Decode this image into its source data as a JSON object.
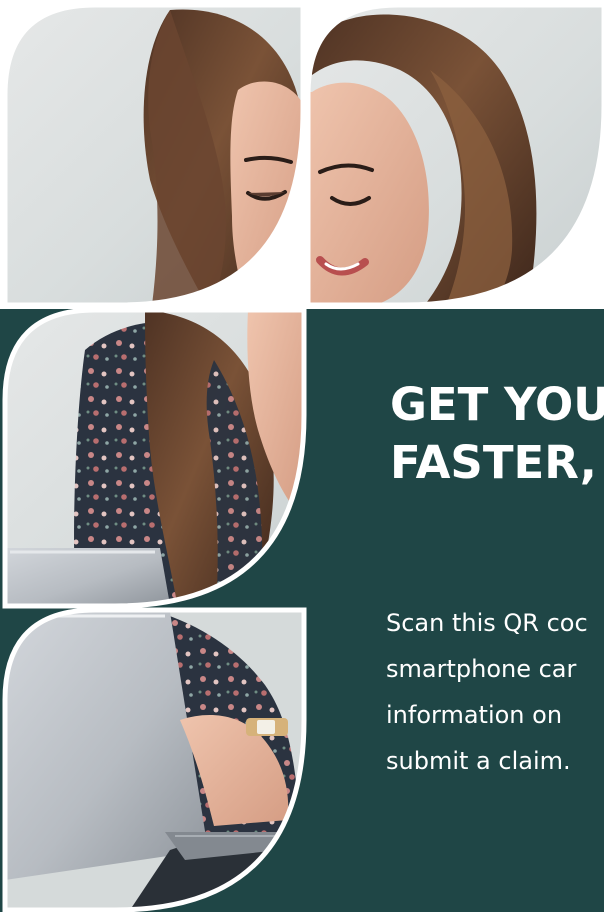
{
  "headline": {
    "line_1": "GET YOU",
    "line_2": "FASTER,"
  },
  "body_copy": {
    "line_1": "Scan this QR coc",
    "line_2": "smartphone car",
    "line_3": "information on",
    "line_4": "submit a claim."
  },
  "colors": {
    "panel": "#1f4646",
    "text": "#ffffff",
    "tile_border": "#ffffff"
  },
  "image_subject": "woman with long brown hair smiling at a laptop"
}
